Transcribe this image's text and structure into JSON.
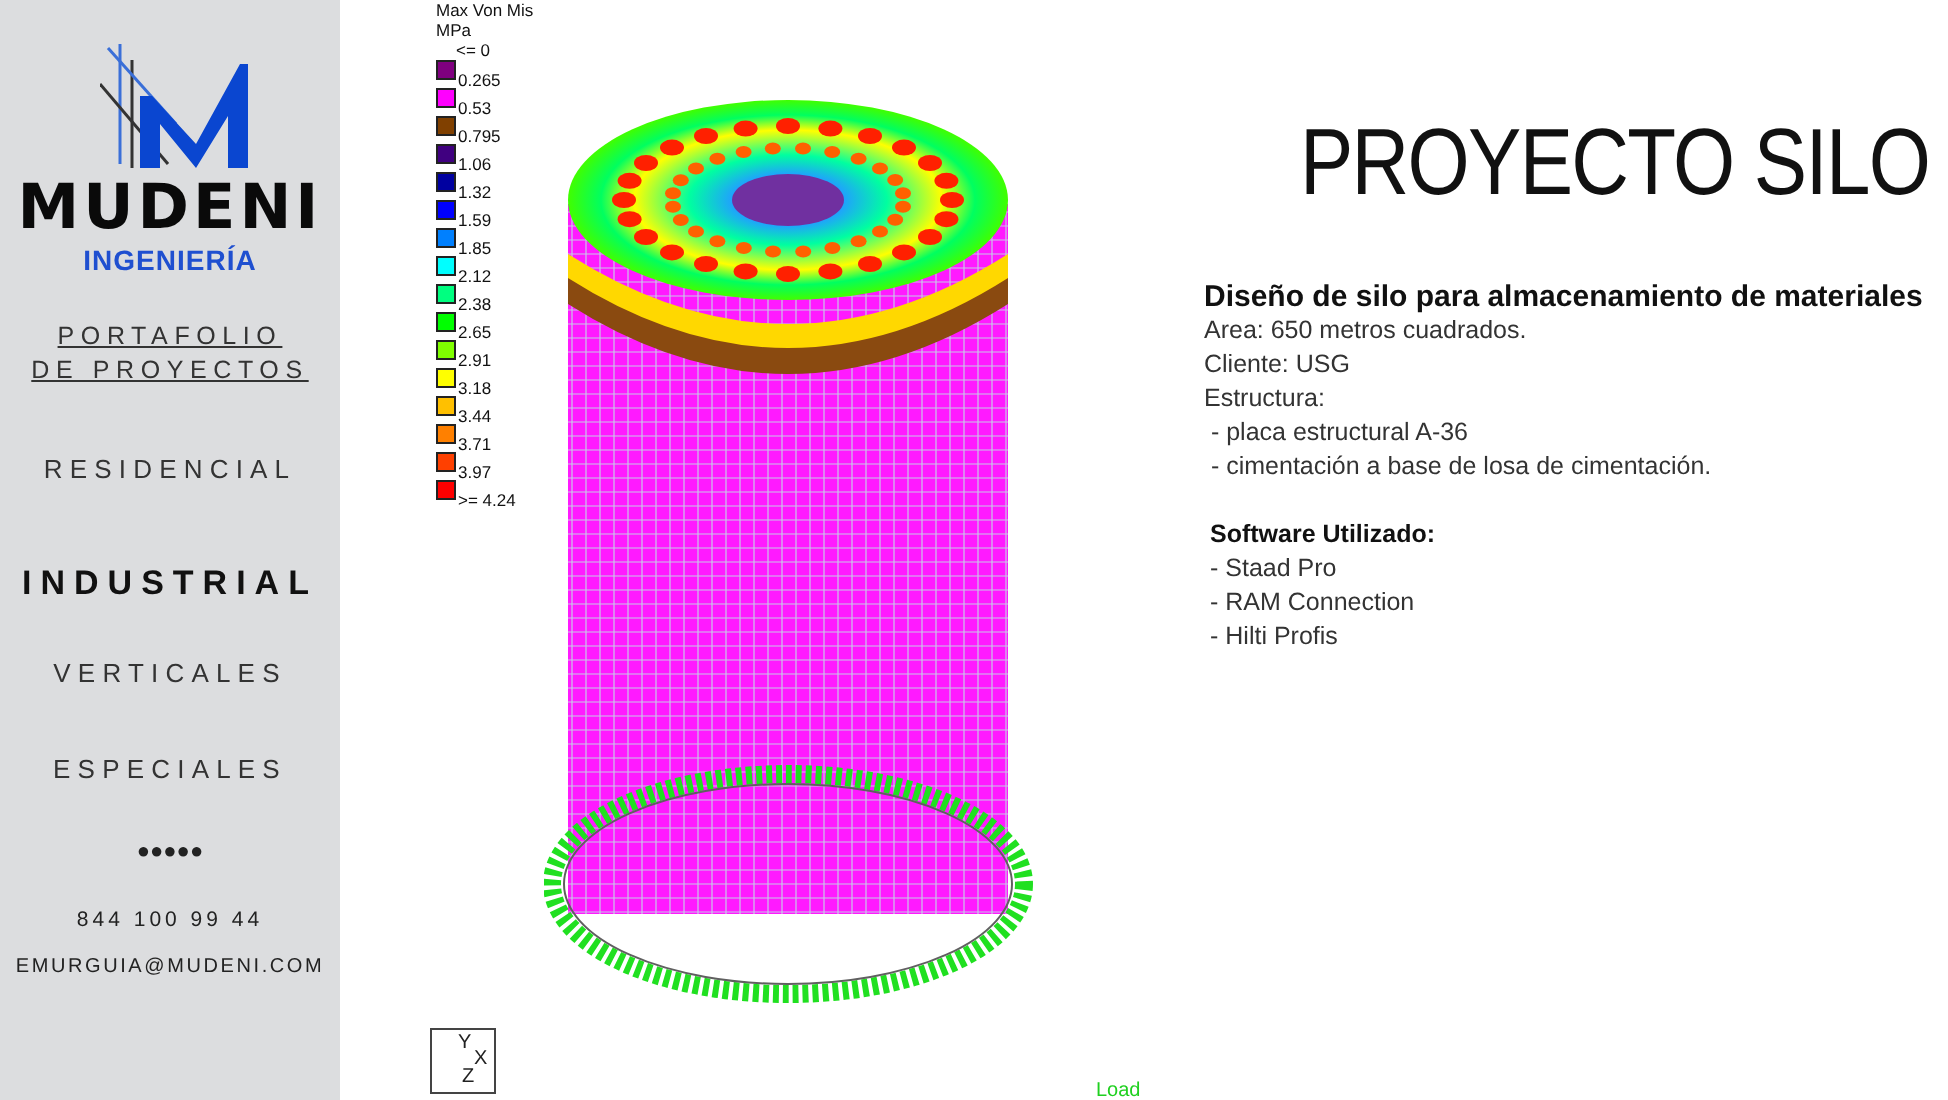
{
  "sidebar": {
    "logo": {
      "wordmark": "MUDENI",
      "tagline": "INGENIERÍA"
    },
    "section_link": "PORTAFOLIO DE PROYECTOS",
    "nav_items": [
      {
        "label": "RESIDENCIAL",
        "selected": false
      },
      {
        "label": "INDUSTRIAL",
        "selected": true
      },
      {
        "label": "VERTICALES",
        "selected": false
      },
      {
        "label": "ESPECIALES",
        "selected": false
      }
    ],
    "dots": "●●●●●",
    "phone": "844 100 99 44",
    "email": "EMURGUIA@MUDENI.COM"
  },
  "viewport": {
    "legend": {
      "title": "Max Von Mis",
      "unit": "MPa",
      "start_label": "<= 0",
      "items": [
        {
          "label": "0.265",
          "color": "#800080"
        },
        {
          "label": "0.53",
          "color": "#ff00ff"
        },
        {
          "label": "0.795",
          "color": "#804000"
        },
        {
          "label": "1.06",
          "color": "#400080"
        },
        {
          "label": "1.32",
          "color": "#0000a0"
        },
        {
          "label": "1.59",
          "color": "#0000ff"
        },
        {
          "label": "1.85",
          "color": "#0080ff"
        },
        {
          "label": "2.12",
          "color": "#00ffff"
        },
        {
          "label": "2.38",
          "color": "#00ff80"
        },
        {
          "label": "2.65",
          "color": "#00ff00"
        },
        {
          "label": "2.91",
          "color": "#80ff00"
        },
        {
          "label": "3.18",
          "color": "#ffff00"
        },
        {
          "label": "3.44",
          "color": "#ffc000"
        },
        {
          "label": "3.71",
          "color": "#ff8000"
        },
        {
          "label": "3.97",
          "color": "#ff4000"
        },
        {
          "label": ">= 4.24",
          "color": "#ff0000"
        }
      ]
    },
    "axes": {
      "y": "Y",
      "x": "X",
      "z": "Z"
    },
    "load_label": "Load"
  },
  "project": {
    "title": "PROYECTO SILO",
    "heading": "Diseño de silo para almacenamiento de materiales",
    "lines": [
      "Area: 650 metros cuadrados.",
      "Cliente: USG",
      "Estructura:",
      " - placa estructural A-36",
      " - cimentación a base de losa de cimentación."
    ],
    "software_heading": "Software Utilizado:",
    "software": [
      "- Staad Pro",
      "- RAM Connection",
      "- Hilti Profis"
    ]
  }
}
